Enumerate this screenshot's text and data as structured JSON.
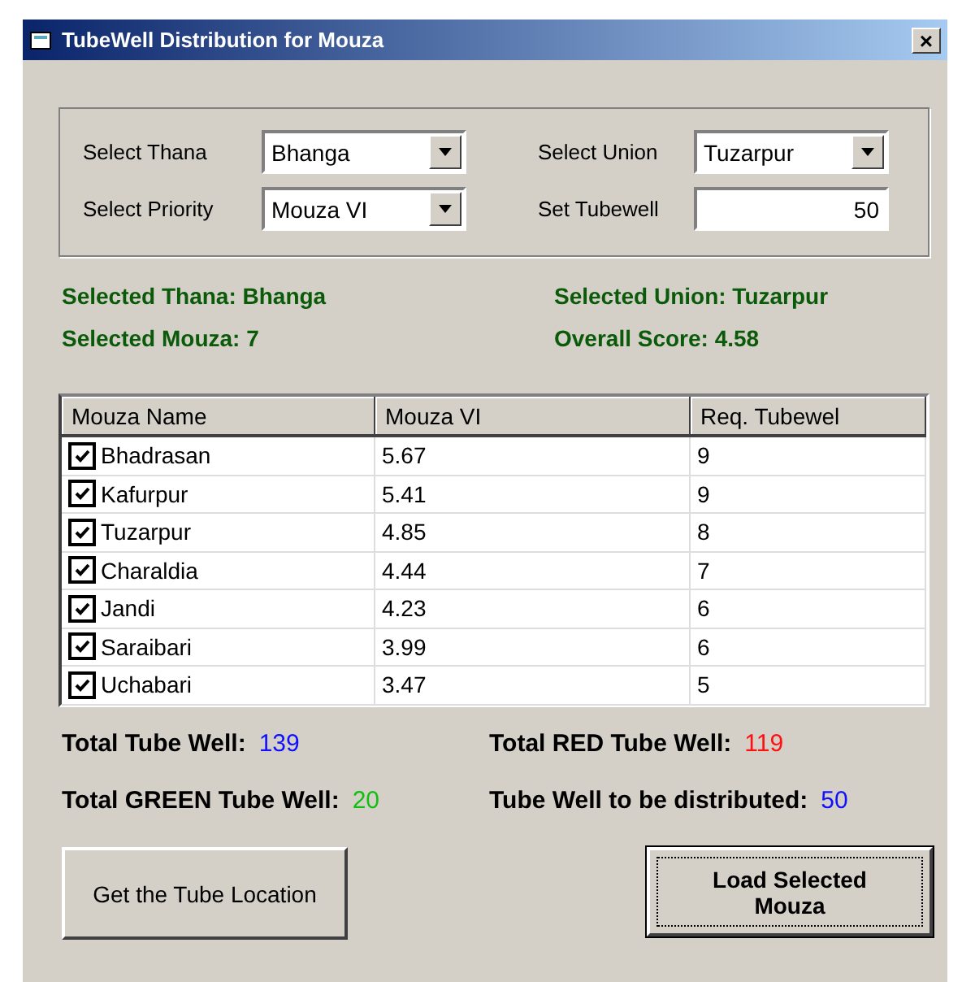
{
  "window": {
    "title": "TubeWell Distribution for Mouza",
    "close": "×"
  },
  "filters": [
    {
      "kind": "combo",
      "label": "Select Thana",
      "value": "Bhanga"
    },
    {
      "kind": "combo",
      "label": "Select Union",
      "value": "Tuzarpur"
    },
    {
      "kind": "combo",
      "label": "Select Priority",
      "value": "Mouza VI"
    },
    {
      "kind": "input",
      "label": "Set Tubewell",
      "value": "50"
    }
  ],
  "summary": [
    "Selected Thana: Bhanga",
    "Selected Union: Tuzarpur",
    "Selected Mouza: 7",
    "Overall Score: 4.58"
  ],
  "table": {
    "columns": [
      "Mouza Name",
      "Mouza VI",
      "Req. Tubewel"
    ],
    "rows": [
      {
        "checked": true,
        "cells": [
          "Bhadrasan",
          "5.67",
          "9"
        ]
      },
      {
        "checked": true,
        "cells": [
          "Kafurpur",
          "5.41",
          "9"
        ]
      },
      {
        "checked": true,
        "cells": [
          "Tuzarpur",
          "4.85",
          "8"
        ]
      },
      {
        "checked": true,
        "cells": [
          "Charaldia",
          "4.44",
          "7"
        ]
      },
      {
        "checked": true,
        "cells": [
          "Jandi",
          "4.23",
          "6"
        ]
      },
      {
        "checked": true,
        "cells": [
          "Saraibari",
          "3.99",
          "6"
        ]
      },
      {
        "checked": true,
        "cells": [
          "Uchabari",
          "3.47",
          "5"
        ]
      }
    ]
  },
  "totals": [
    {
      "label": "Total Tube Well:",
      "value": "139",
      "color": "#1010ff"
    },
    {
      "label": "Total RED Tube Well:",
      "value": "119",
      "color": "#ff1010"
    },
    {
      "label": "Total GREEN Tube Well:",
      "value": "20",
      "color": "#10c010"
    },
    {
      "label": "Tube Well to be distributed:",
      "value": "50",
      "color": "#1010ff"
    }
  ],
  "buttons": [
    {
      "label": "Get the Tube Location",
      "default": false
    },
    {
      "label": "Load Selected Mouza",
      "default": true
    }
  ]
}
